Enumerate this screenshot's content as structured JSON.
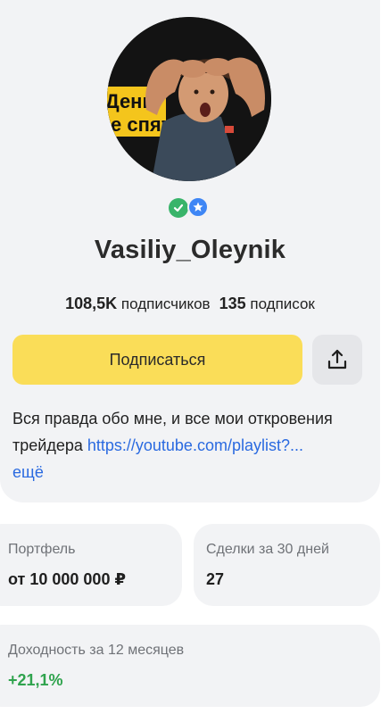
{
  "profile": {
    "username": "Vasiliy_Oleynik",
    "badges": [
      "verified-badge-icon",
      "star-badge-icon"
    ],
    "avatar_caption_line1": "Деньг",
    "avatar_caption_line2": "е спят"
  },
  "stats": {
    "followers_count": "108,5K",
    "followers_label": "подписчиков",
    "following_count": "135",
    "following_label": "подписок"
  },
  "actions": {
    "subscribe_label": "Подписаться",
    "share_icon": "share-upload-icon"
  },
  "bio": {
    "text": "Вся правда обо мне, и все мои откровения трейдера ",
    "link": "https://youtube.com/playlist?...",
    "more_label": "ещё"
  },
  "cards": {
    "portfolio": {
      "label": "Портфель",
      "value": "от 10 000 000 ₽"
    },
    "deals": {
      "label": "Сделки за 30 дней",
      "value": "27"
    },
    "yield": {
      "label": "Доходность за 12 месяцев",
      "value": "+21,1%"
    }
  },
  "colors": {
    "accent_yellow": "#fadd58",
    "link_blue": "#2a6ae0",
    "positive_green": "#2fa34d",
    "card_bg": "#f2f3f5"
  }
}
